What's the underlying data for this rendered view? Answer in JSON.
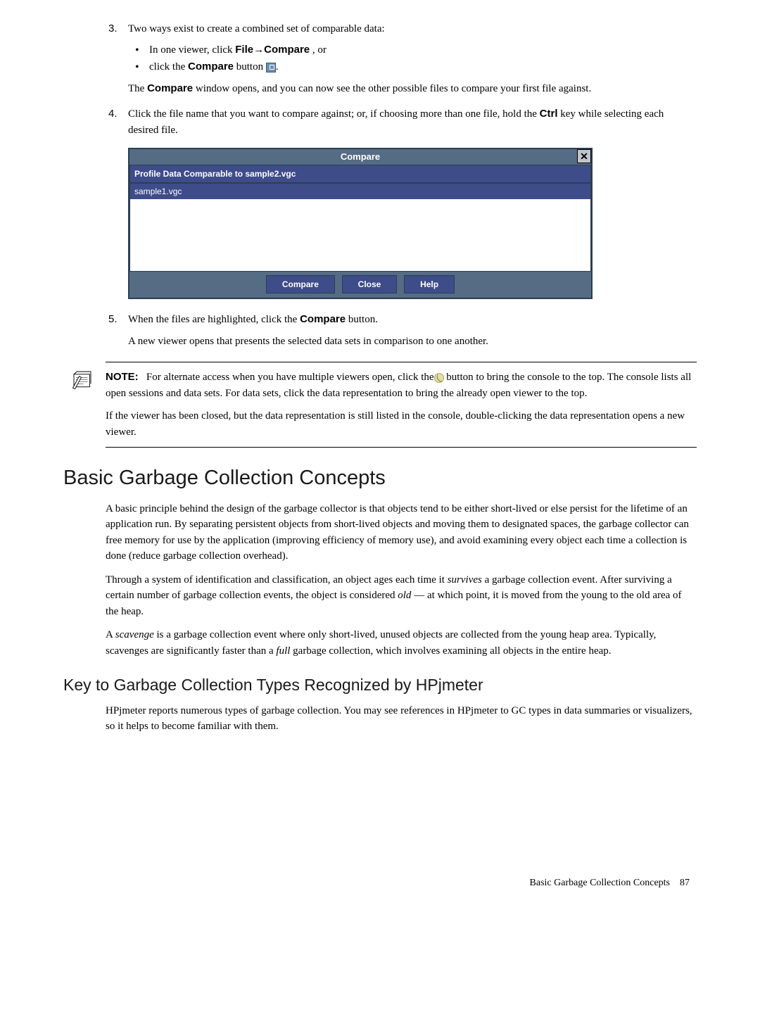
{
  "steps": {
    "s3_intro": "Two ways exist to create a combined set of comparable data:",
    "s3_bullets": [
      "In one viewer, click ",
      "click the "
    ],
    "s3_b1_file": "File",
    "s3_b1_arrow": "→",
    "s3_b1_compare": "Compare",
    "s3_b1_tail": " , or",
    "s3_b2_compare": "Compare",
    "s3_b2_button": " button ",
    "s3_b2_period": ".",
    "s3_para": "The ",
    "s3_para_compare": "Compare",
    "s3_para_tail": " window opens, and you can now see the other possible files to compare your first file against.",
    "s4_text": "Click the file name that you want to compare against; or, if choosing more than one file, hold the ",
    "s4_ctrl": "Ctrl",
    "s4_tail": " key while selecting each desired file.",
    "s5_text": "When the files are highlighted, click the ",
    "s5_compare": "Compare",
    "s5_tail": " button.",
    "s5_para": "A new viewer opens that presents the selected data sets in comparison to one another."
  },
  "dialog": {
    "title": "Compare",
    "close": "✕",
    "profile_label": "Profile Data Comparable to sample2.vgc",
    "row": "sample1.vgc",
    "btn_compare": "Compare",
    "btn_close": "Close",
    "btn_help": "Help"
  },
  "note": {
    "label": "NOTE:",
    "p1a": "For alternate access when you have multiple viewers open, click the",
    "p1b": " button to bring the console to the top. The console lists all open sessions and data sets. For data sets, click the data representation to bring the already open viewer to the top.",
    "p2": "If the viewer has been closed, but the data representation is still listed in the console, double-clicking the data representation opens a new viewer."
  },
  "section": {
    "h2": "Basic Garbage Collection Concepts",
    "p1": "A basic principle behind the design of the garbage collector is that objects tend to be either short-lived or else persist for the lifetime of an application run. By separating persistent objects from short-lived objects and moving them to designated spaces, the garbage collector can free memory for use by the application (improving efficiency of memory use), and avoid examining every object each time a collection is done (reduce garbage collection overhead).",
    "p2a": "Through a system of identification and classification, an object ages each time it ",
    "p2_em1": "survives",
    "p2b": " a garbage collection event. After surviving a certain number of garbage collection events, the object is considered ",
    "p2_em2": "old",
    "p2c": " — at which point, it is moved from the young to the old area of the heap.",
    "p3a": "A ",
    "p3_em1": "scavenge",
    "p3b": " is a garbage collection event where only short-lived, unused objects are collected from the young heap area. Typically, scavenges are significantly faster than a ",
    "p3_em2": "full",
    "p3c": " garbage collection, which involves examining all objects in the entire heap."
  },
  "subsection": {
    "h3": "Key to Garbage Collection Types Recognized by HPjmeter",
    "p1": "HPjmeter reports numerous types of garbage collection. You may see references in HPjmeter to GC types in data summaries or visualizers, so it helps to become familiar with them."
  },
  "footer": {
    "text": "Basic Garbage Collection Concepts",
    "page": "87"
  }
}
